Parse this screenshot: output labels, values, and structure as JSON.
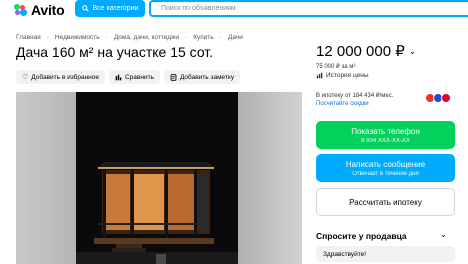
{
  "header": {
    "logo_text": "Avito",
    "categories_label": "Все категории",
    "search_placeholder": "Поиск по объявлениям"
  },
  "breadcrumbs": [
    "Главная",
    "Недвижимость",
    "Дома, дачи, коттеджи",
    "Купить",
    "Дачи"
  ],
  "listing": {
    "title": "Дача 160 м² на участке 15 сот.",
    "price": "12 000 000 ₽",
    "price_per_m": "75 000 ₽ за м²",
    "price_history": "История цены"
  },
  "actions": {
    "favorite": "Добавить в избранное",
    "compare": "Сравнить",
    "note": "Добавить заметку"
  },
  "mortgage": {
    "text": "В ипотеку от 184 434 ₽/мес.",
    "link": "Посчитайте скидки"
  },
  "contact": {
    "phone_label": "Показать телефон",
    "phone_number": "8 934 XXX-XX-XX",
    "message_label": "Написать сообщение",
    "message_sub": "Отвечает в течение дня",
    "mortgage_calc": "Рассчитать ипотеку",
    "ask_seller": "Спросите у продавца",
    "greeting": "Здравствуйте!"
  },
  "colors": {
    "accent": "#00AAFF",
    "phone_green": "#02D15C",
    "link": "#0A74D1"
  }
}
